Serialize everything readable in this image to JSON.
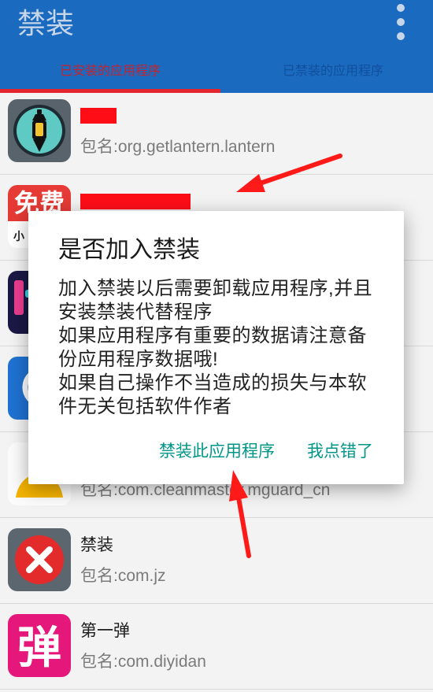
{
  "app_bar": {
    "title": "禁装",
    "menu_icon": "more-vert-icon"
  },
  "tabs": [
    {
      "label": "已安装的应用程序",
      "selected": true
    },
    {
      "label": "已禁装的应用程序",
      "selected": false
    }
  ],
  "app_list": [
    {
      "name_redacted": true,
      "package": "包名:org.getlantern.lantern",
      "icon": "lantern-icon"
    },
    {
      "name_redacted": true,
      "icon": "free-app-icon",
      "icon_text": "免费",
      "icon_subtext": "小"
    },
    {
      "icon": "app-icon"
    },
    {
      "icon": "app-icon"
    },
    {
      "package": "包名:com.cleanmaster.mguard_cn",
      "icon": "clean-master-icon"
    },
    {
      "name": "禁装",
      "package": "包名:com.jz",
      "icon": "block-x-icon"
    },
    {
      "name": "第一弹",
      "package": "包名:com.diyidan",
      "icon": "diyidan-icon",
      "icon_text": "弹"
    }
  ],
  "dialog": {
    "title": "是否加入禁装",
    "message_lines": [
      "加入禁装以后需要卸载应用程序,并且",
      "安装禁装代替程序",
      "如果应用程序有重要的数据请注意备",
      "份应用程序数据哦!",
      "如果自己操作不当造成的损失与本软",
      "件无关包括软件作者"
    ],
    "confirm_label": "禁装此应用程序",
    "cancel_label": "我点错了"
  },
  "annotations": {
    "icon": "red-arrow-icon"
  },
  "colors": {
    "app_bar": "#1a6bbf",
    "title_text": "#c7d5e8",
    "tab_selected": "#c6232d",
    "tab_unselected": "#114f9c",
    "tab_indicator": "#e3262d",
    "list_background": "#f3f3f3",
    "divider": "#d9d9d9",
    "name_text": "#1d1d1d",
    "package_text": "#7b7b7b",
    "dialog_button": "#009688",
    "redaction": "#ff0d17",
    "annotation_arrow": "#ff1a1a"
  }
}
